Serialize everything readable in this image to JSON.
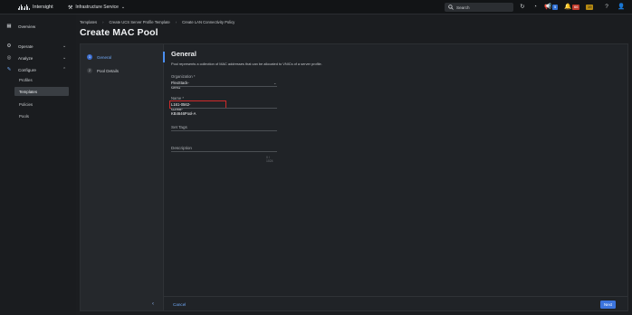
{
  "topbar": {
    "brand": "Intersight",
    "service": "Infrastructure Service",
    "search_placeholder": "Search",
    "notif_count": "5",
    "alarm_critical": "66",
    "alarm_warning": "19"
  },
  "nav": {
    "overview": "Overview",
    "operate": "Operate",
    "analyze": "Analyze",
    "configure": "Configure",
    "profiles": "Profiles",
    "templates": "Templates",
    "policies": "Policies",
    "pools": "Pools"
  },
  "breadcrumb": [
    "Templates",
    "Create UCS Server Profile Template",
    "Create LAN Connectivity Policy"
  ],
  "page_title": "Create MAC Pool",
  "steps": [
    {
      "num": "1",
      "label": "General"
    },
    {
      "num": "2",
      "label": "Pool Details"
    }
  ],
  "form": {
    "section_title": "General",
    "description": "Pool represents a collection of MAC addresses that can be allocated to VNICs of a server profile.",
    "organization_label": "Organization *",
    "organization_value": "FlexStack-Gen1",
    "name_label": "Name *",
    "name_value": "L161-0562-G2NS-KB4646Pool-A",
    "set_tags_label": "Set Tags",
    "description_label": "Description",
    "description_counter": "0 / 1024"
  },
  "footer": {
    "cancel": "Cancel",
    "next": "Next"
  }
}
